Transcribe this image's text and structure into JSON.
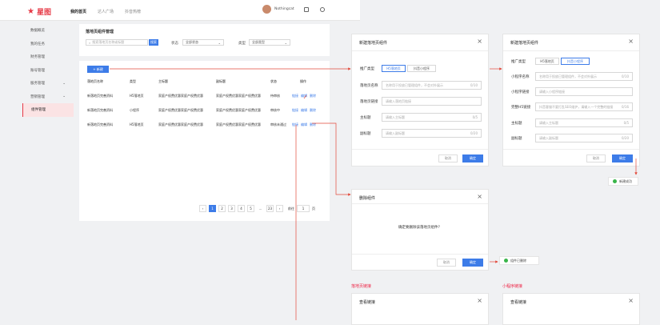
{
  "topbar": {
    "logo": "星图",
    "nav": [
      "我的首页",
      "达人广场",
      "抖音热榜"
    ],
    "username": "Nothingcat"
  },
  "sidebar": {
    "items": [
      {
        "label": "数据概览",
        "arrow": ""
      },
      {
        "label": "我的任务",
        "arrow": ""
      },
      {
        "label": "财务管理",
        "arrow": ""
      },
      {
        "label": "账号管理",
        "arrow": ""
      },
      {
        "label": "服务管理",
        "arrow": "⌄"
      },
      {
        "label": "营销管理",
        "arrow": "⌄"
      },
      {
        "label": "组件管理",
        "arrow": ""
      }
    ]
  },
  "filter": {
    "title": "落地页组件管理",
    "search_placeholder": "搜索落地页名称或标题",
    "search_btn": "搜索",
    "status_label": "状态",
    "status_value": "全部状态",
    "type_label": "类型",
    "type_value": "全部类型"
  },
  "list": {
    "new_btn": "+ 新建",
    "headers": [
      "落地页名称",
      "类型",
      "主标题",
      "副标题",
      "状态",
      "操作"
    ],
    "rows": [
      {
        "name": "新落地页完善资料",
        "type": "H5落地页",
        "title": "家庭产权费优惠家庭产权费优惠",
        "subtitle": "家庭产权费优惠家庭产权费优惠",
        "status": "待审核",
        "ops": [
          "链接",
          "编辑",
          "删除"
        ]
      },
      {
        "name": "新落地页完善资料",
        "type": "小程序",
        "title": "家庭产权费优惠家庭产权费优惠",
        "subtitle": "家庭产权费优惠家庭产权费优惠",
        "status": "审核中",
        "ops": [
          "链接",
          "编辑",
          "删除"
        ]
      },
      {
        "name": "新落地页完善资料",
        "type": "H5落地页",
        "title": "家庭产权费优惠家庭产权费优惠",
        "subtitle": "家庭产权费优惠家庭产权费优惠",
        "status": "审核未通过",
        "ops": [
          "链接",
          "编辑",
          "删除"
        ]
      }
    ],
    "pager": {
      "pages": [
        "‹",
        "1",
        "2",
        "3",
        "4",
        "5",
        "…",
        "23",
        "›"
      ],
      "current": "1",
      "goto_label": "前往",
      "goto_value": "1",
      "page_suffix": "页"
    }
  },
  "modal_h5": {
    "title": "新建落地页组件",
    "type_label": "推广类型",
    "type_options": [
      "H5落地页",
      "抖音小程序"
    ],
    "fields": [
      {
        "label": "落地页名称",
        "placeholder": "名称用于投放已管理组件，不会对外展示",
        "count": "0/10"
      },
      {
        "label": "落地页链接",
        "placeholder": "请输入落地页链接",
        "count": ""
      },
      {
        "label": "主标题",
        "placeholder": "请输入主标题",
        "count": "0/5"
      },
      {
        "label": "副标题",
        "placeholder": "请输入副标题",
        "count": "0/20"
      }
    ],
    "cancel": "取消",
    "ok": "确定"
  },
  "modal_mini": {
    "title": "新建落地页组件",
    "type_label": "推广类型",
    "type_options": [
      "H5落地页",
      "抖音小程序"
    ],
    "fields": [
      {
        "label": "小程序名称",
        "placeholder": "名称用于投放已管理组件，不会对外展示",
        "count": "0/10"
      },
      {
        "label": "小程序链接",
        "placeholder": "请输入小程序链接",
        "count": ""
      },
      {
        "label": "完整H5链接",
        "placeholder": "抖音客服不要打乱SEO维护，请输入一个完整的链接",
        "count": "0/16"
      },
      {
        "label": "主标题",
        "placeholder": "请输入主标题",
        "count": "0/5"
      },
      {
        "label": "副标题",
        "placeholder": "请输入副标题",
        "count": "0/20"
      }
    ],
    "cancel": "取消",
    "ok": "确定"
  },
  "toast_new": {
    "text": "新建成功"
  },
  "modal_delete": {
    "title": "删除组件",
    "message": "确定要删除该落地页组件？",
    "cancel": "取消",
    "ok": "确定"
  },
  "toast_delete": {
    "text": "组件已删除"
  },
  "link_view": {
    "h5_caption": "落地页链接",
    "mini_caption": "小程序链接",
    "title": "查看链接"
  },
  "colors": {
    "accent": "#3d7ce8",
    "brand": "#e63946",
    "arrow": "#e24a3b",
    "success": "#39b54a"
  }
}
